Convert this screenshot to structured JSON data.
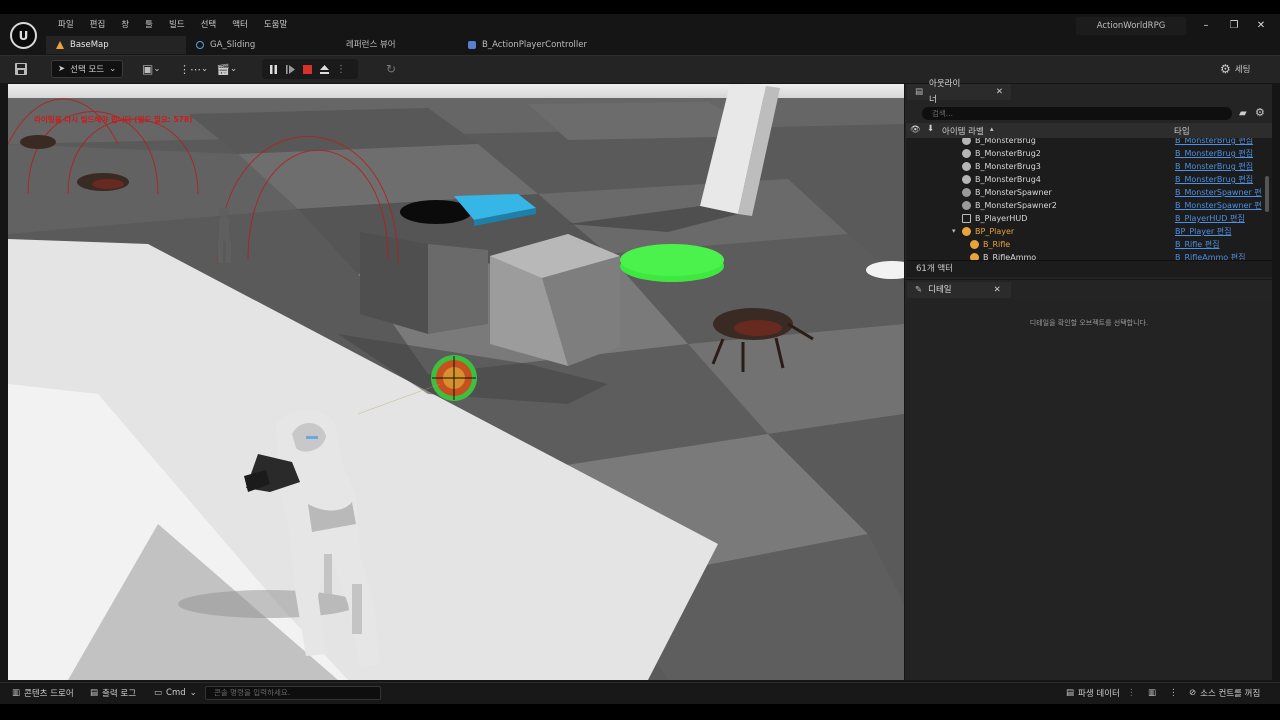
{
  "menu": [
    "파일",
    "편집",
    "창",
    "툴",
    "빌드",
    "선택",
    "액터",
    "도움말"
  ],
  "project_name": "ActionWorldRPG",
  "tabs": [
    {
      "label": "BaseMap",
      "active": true
    },
    {
      "label": "GA_Sliding",
      "active": false
    },
    {
      "label": "레퍼런스 뷰어",
      "active": false
    },
    {
      "label": "B_ActionPlayerController",
      "active": false
    }
  ],
  "toolbar": {
    "mode_label": "선택 모드",
    "settings_label": "세팅"
  },
  "viewport": {
    "message": "라이팅을 다시 빌드해야 합니다 (빌드 필요: 578)"
  },
  "outliner": {
    "tab_label": "아웃라이너",
    "search_placeholder": "검색...",
    "col_label": "아이템 라벨",
    "col_type": "타입",
    "rows": [
      {
        "name": "B_MonsterBrug",
        "type": "B_MonsterBrug 편집"
      },
      {
        "name": "B_MonsterBrug2",
        "type": "B_MonsterBrug 편집"
      },
      {
        "name": "B_MonsterBrug3",
        "type": "B_MonsterBrug 편집"
      },
      {
        "name": "B_MonsterBrug4",
        "type": "B_MonsterBrug 편집"
      },
      {
        "name": "B_MonsterSpawner",
        "type": "B_MonsterSpawner 편"
      },
      {
        "name": "B_MonsterSpawner2",
        "type": "B_MonsterSpawner 편"
      },
      {
        "name": "B_PlayerHUD",
        "type": "B_PlayerHUD 편집"
      },
      {
        "name": "BP_Player",
        "type": "BP_Player 편집"
      },
      {
        "name": "B_Rifle",
        "type": "B_Rifle 편집"
      },
      {
        "name": "B_RifleAmmo",
        "type": "B_RifleAmmo 편집"
      }
    ],
    "actor_count": "61개 액터"
  },
  "details": {
    "tab_label": "디테일",
    "empty_message": "디테일을 확인할 오브젝트를 선택합니다."
  },
  "statusbar": {
    "content_drawer": "콘텐츠 드로어",
    "output_log": "출력 로그",
    "cmd": "Cmd",
    "cmd_placeholder": "콘솔 명령을 입력하세요.",
    "derived_data": "파생 데이터",
    "source_control": "소스 컨트롤 꺼짐"
  },
  "colors": {
    "accent_orange": "#e8a33a",
    "link_blue": "#4d8fe0",
    "stop_red": "#d9302c",
    "green_disc": "#3fe83f",
    "cyan_tile": "#35b6e6"
  }
}
